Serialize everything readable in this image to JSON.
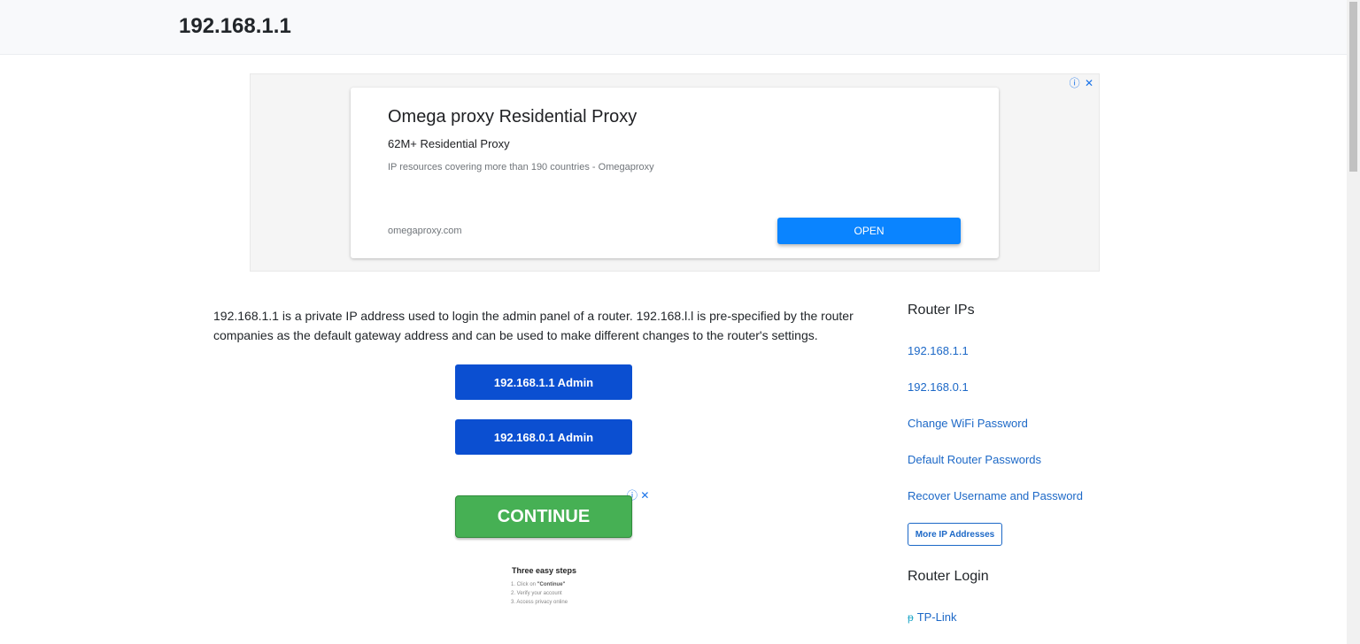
{
  "header": {
    "site_title": "192.168.1.1"
  },
  "ad_banner": {
    "info_icon": "ⓘ",
    "close_icon": "✕",
    "title": "Omega proxy Residential Proxy",
    "subtitle": "62M+ Residential Proxy",
    "description": "IP resources covering more than 190 countries - Omegaproxy",
    "domain": "omegaproxy.com",
    "open_label": "OPEN"
  },
  "main": {
    "intro": "192.168.1.1 is a private IP address used to login the admin panel of a router. 192.168.l.l is pre-specified by the router companies as the default gateway address and can be used to make different changes to the router's settings.",
    "admin_buttons": [
      {
        "label": "192.168.1.1 Admin"
      },
      {
        "label": "192.168.0.1 Admin"
      }
    ]
  },
  "ad_continue": {
    "info_icon": "ⓘ",
    "close_icon": "✕",
    "continue_label": "CONTINUE",
    "steps_title": "Three easy steps",
    "steps": [
      {
        "prefix": "1. Click on ",
        "bold": "\"Continue\""
      },
      {
        "prefix": "2. Verify your account",
        "bold": ""
      },
      {
        "prefix": "3. Access privacy online",
        "bold": ""
      }
    ]
  },
  "sidebar": {
    "router_ips_heading": "Router IPs",
    "links": [
      {
        "label": "192.168.1.1"
      },
      {
        "label": "192.168.0.1"
      },
      {
        "label": "Change WiFi Password"
      },
      {
        "label": "Default Router Passwords"
      },
      {
        "label": "Recover Username and Password"
      }
    ],
    "more_button": "More IP Addresses",
    "router_login_heading": "Router Login",
    "login_links": [
      {
        "label": "TP-Link",
        "icon": "tplink-icon"
      }
    ]
  },
  "colors": {
    "accent": "#0b4fd1",
    "link": "#1c68c7",
    "ad_open": "#0a84ff",
    "continue": "#46b054"
  }
}
